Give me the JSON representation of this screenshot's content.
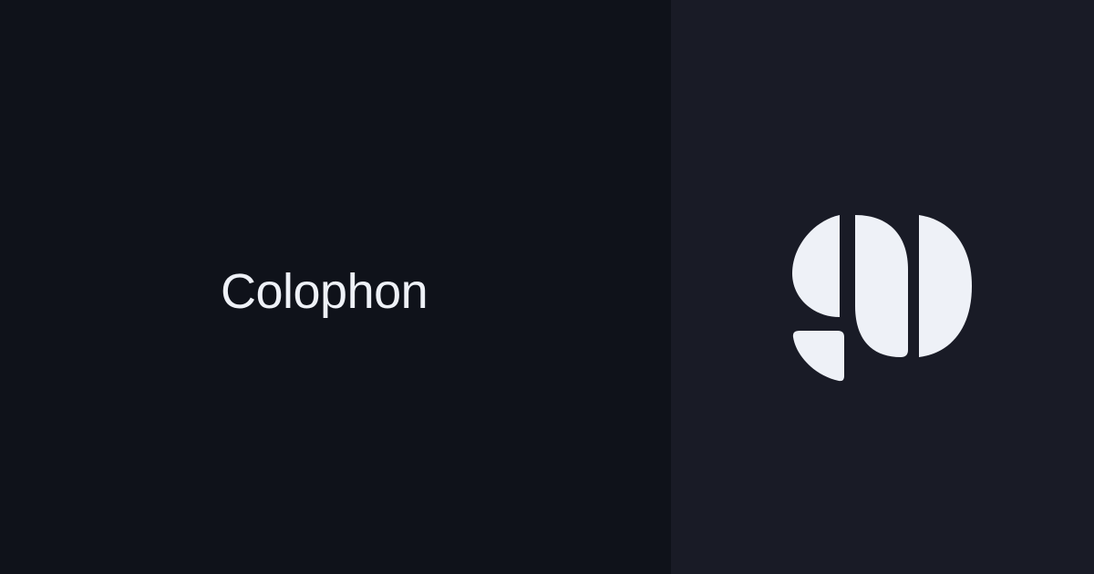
{
  "page": {
    "title": "Colophon"
  },
  "logo": {
    "icon": "abstract-g-logo-icon"
  },
  "colors": {
    "left_background": "#0f121a",
    "right_background": "#191b26",
    "title_text": "#eef1f7",
    "logo_fill": "#eef1f7"
  }
}
